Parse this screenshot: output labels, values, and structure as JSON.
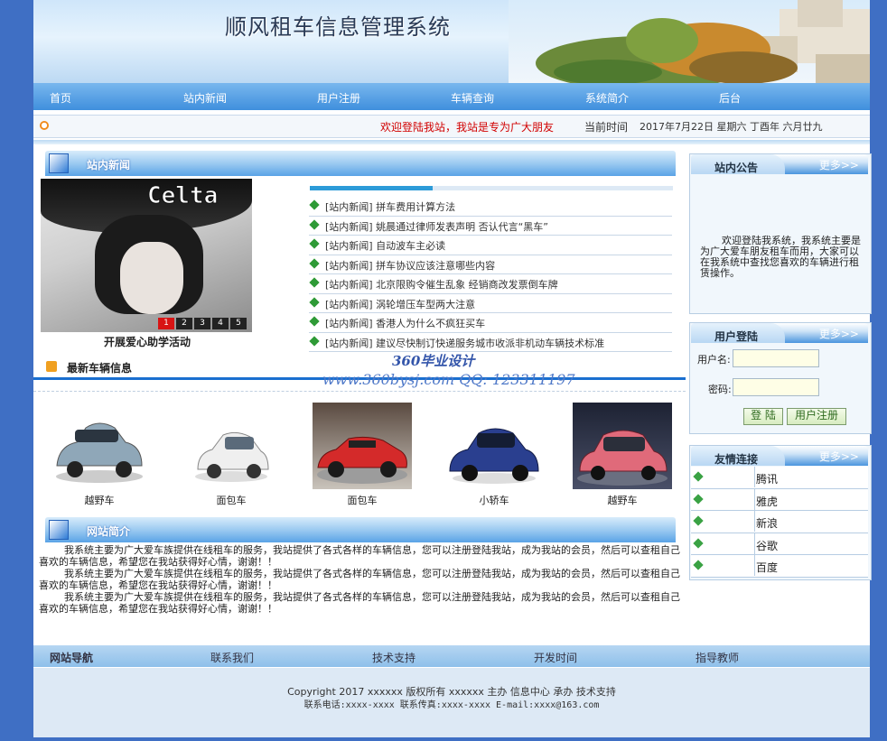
{
  "header": {
    "title": "顺风租车信息管理系统"
  },
  "nav": {
    "items": [
      "首页",
      "站内新闻",
      "用户注册",
      "车辆查询",
      "系统简介",
      "后台"
    ]
  },
  "marquee": {
    "text": "欢迎登陆我站，我站是专为广大朋友",
    "time_label": "当前时间",
    "time_value": "2017年7月22日 星期六 丁酉年 六月廿九"
  },
  "news": {
    "title": "站内新闻",
    "photo_logo": "Celta",
    "photo_caption": "开展爱心助学活动",
    "pager": [
      "1",
      "2",
      "3",
      "4",
      "5"
    ],
    "items": [
      "[站内新闻] 拼车费用计算方法",
      "[站内新闻] 姚晨通过律师发表声明 否认代言“黑车”",
      "[站内新闻] 自动波车主必读",
      "[站内新闻] 拼车协议应该注意哪些内容",
      "[站内新闻] 北京限购令催生乱象 经销商改发票倒车牌",
      "[站内新闻] 涡轮增压车型两大注意",
      "[站内新闻] 香港人为什么不疯狂买车",
      "[站内新闻] 建议尽快制订快递服务城市收派非机动车辆技术标准"
    ]
  },
  "cars": {
    "title": "最新车辆信息",
    "items": [
      {
        "name": "越野车",
        "color": "#8fa7b8"
      },
      {
        "name": "面包车",
        "color": "#e8e8e8"
      },
      {
        "name": "面包车",
        "color": "#d42a2a"
      },
      {
        "name": "小轿车",
        "color": "#2a3f8f"
      },
      {
        "name": "越野车",
        "color": "#e06a7a"
      }
    ]
  },
  "watermark": {
    "line1": "360毕业设计",
    "line2": "www.360bysj.com     QQ: 123311197"
  },
  "intro": {
    "title": "网站简介",
    "paragraphs": [
      "我系统主要为广大爱车族提供在线租车的服务，我站提供了各式各样的车辆信息，您可以注册登陆我站，成为我站的会员，然后可以查租自己喜欢的车辆信息，希望您在我站获得好心情，谢谢！！",
      "我系统主要为广大爱车族提供在线租车的服务，我站提供了各式各样的车辆信息，您可以注册登陆我站，成为我站的会员，然后可以查租自己喜欢的车辆信息，希望您在我站获得好心情，谢谢！！",
      "我系统主要为广大爱车族提供在线租车的服务，我站提供了各式各样的车辆信息，您可以注册登陆我站，成为我站的会员，然后可以查租自己喜欢的车辆信息，希望您在我站获得好心情，谢谢！！"
    ]
  },
  "sidebar": {
    "notice": {
      "title": "站内公告",
      "more": "更多>>",
      "text": "欢迎登陆我系统，我系统主要是为广大爱车朋友租车而用，大家可以在我系统中查找您喜欢的车辆进行租赁操作。"
    },
    "login": {
      "title": "用户登陆",
      "more": "更多>>",
      "username_label": "用户名:",
      "password_label": "密码:",
      "login_button": "登 陆",
      "register_button": "用户注册"
    },
    "links": {
      "title": "友情连接",
      "more": "更多>>",
      "items": [
        "腾讯",
        "雅虎",
        "新浪",
        "谷歌",
        "百度"
      ]
    }
  },
  "footer": {
    "nav": [
      "网站导航",
      "联系我们",
      "技术支持",
      "开发时间",
      "指导教师"
    ],
    "copyright": "Copyright 2017 xxxxxx 版权所有 xxxxxx 主办 信息中心 承办 技术支持",
    "contact": "联系电话:xxxx-xxxx 联系传真:xxxx-xxxx E-mail:xxxx@163.com"
  }
}
